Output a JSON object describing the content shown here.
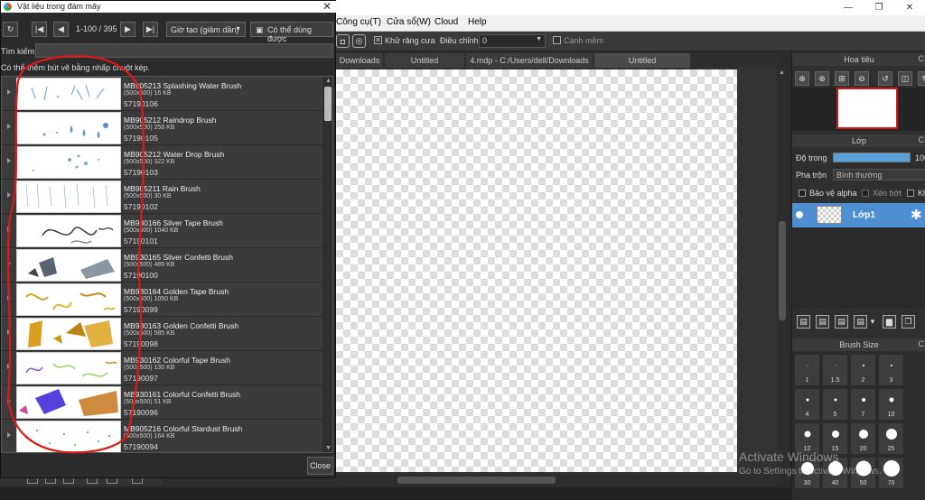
{
  "app": {
    "menu": [
      "Công cụ(T)",
      "Cửa sổ(W)",
      "Cloud",
      "Help"
    ],
    "window_controls": [
      "—",
      "❐",
      "✕"
    ],
    "toolbar": {
      "antialias_label": "Khử răng cưa",
      "adjust_label": "Điều chỉnh",
      "adjust_value": "0",
      "soft_edge_label": "Cạnh mềm"
    },
    "tabs": [
      "Downloads",
      "Untitled",
      "4.mdp - C:/Users/dell/Downloads",
      "Untitled"
    ],
    "navigator_title": "Hoa tiêu",
    "layer_panel": {
      "title": "Lớp",
      "opacity_label": "Độ trong",
      "opacity_value": "100",
      "blend_label": "Pha trộn",
      "blend_value": "Bình thường",
      "protect_alpha": "Bảo vệ alpha",
      "clip": "Xén bớt",
      "lock_partial": "Kh",
      "layer_name": "Lớp1"
    },
    "brush_size": {
      "title": "Brush Size",
      "cells": [
        {
          "label": "1",
          "dot": 1
        },
        {
          "label": "1.5",
          "dot": 1
        },
        {
          "label": "2",
          "dot": 2
        },
        {
          "label": "3",
          "dot": 2
        },
        {
          "label": "4",
          "dot": 3
        },
        {
          "label": "5",
          "dot": 3
        },
        {
          "label": "7",
          "dot": 4
        },
        {
          "label": "10",
          "dot": 5
        },
        {
          "label": "12",
          "dot": 7
        },
        {
          "label": "15",
          "dot": 8
        },
        {
          "label": "20",
          "dot": 10
        },
        {
          "label": "25",
          "dot": 12
        },
        {
          "label": "30",
          "dot": 14
        },
        {
          "label": "40",
          "dot": 16
        },
        {
          "label": "50",
          "dot": 17
        },
        {
          "label": "70",
          "dot": 18
        }
      ]
    },
    "watermark": {
      "line1": "Activate Windows",
      "line2": "Go to Settings to activate Windows."
    }
  },
  "dialog": {
    "title": "Vật liệu trong đám mây",
    "page_info": "1-100 / 395",
    "sort_value": "Giờ tạo (giảm dần)",
    "usable_label": "Có thể dùng được",
    "search_label": "Tìm kiếm:",
    "search_value": "",
    "hint": "Có thể thêm bút vẽ bằng nhấp chuột kép.",
    "close_label": "Close",
    "items": [
      {
        "name": "MB905213 Splashing Water Brush",
        "size": "(500x500) 16 KB",
        "id": "57190106",
        "style": "water"
      },
      {
        "name": "MB905212 Raindrop Brush",
        "size": "(500x500) 256 KB",
        "id": "57190105",
        "style": "raindrop"
      },
      {
        "name": "MB905212 Water Drop Brush",
        "size": "(500x500) 322 KB",
        "id": "57190103",
        "style": "waterdrop"
      },
      {
        "name": "MB905211 Rain Brush",
        "size": "(500x500) 30 KB",
        "id": "57190102",
        "style": "rain"
      },
      {
        "name": "MB930166 Silver Tape Brush",
        "size": "(500x500) 1040 KB",
        "id": "57190101",
        "style": "silvertape"
      },
      {
        "name": "MB930165 Silver Confetti Brush",
        "size": "(500x500) 489 KB",
        "id": "57190100",
        "style": "silverconfetti"
      },
      {
        "name": "MB930164 Golden Tape Brush",
        "size": "(500x500) 1050 KB",
        "id": "57190099",
        "style": "goldentape"
      },
      {
        "name": "MB930163 Golden Confetti Brush",
        "size": "(500x500) 585 KB",
        "id": "57190098",
        "style": "goldenconfetti"
      },
      {
        "name": "MB930162 Colorful Tape Brush",
        "size": "(500x500) 130 KB",
        "id": "57190097",
        "style": "colorfultape"
      },
      {
        "name": "MB930161 Colorful Confetti Brush",
        "size": "(500x500) 51 KB",
        "id": "57190096",
        "style": "colorfulconfetti"
      },
      {
        "name": "MB905216 Colorful Stardust Brush",
        "size": "(500x500) 164 KB",
        "id": "57190094",
        "style": "stardust"
      }
    ]
  }
}
